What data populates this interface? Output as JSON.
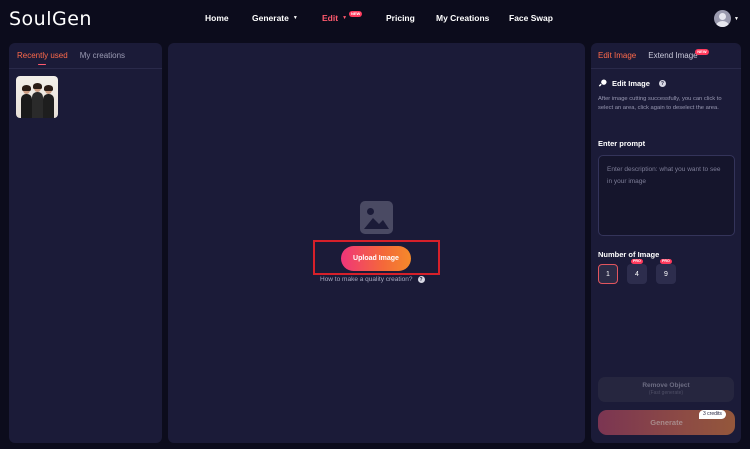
{
  "brand": {
    "logo": "SoulGen"
  },
  "nav": {
    "home": "Home",
    "generate": "Generate",
    "edit": "Edit",
    "edit_badge": "NEW",
    "pricing": "Pricing",
    "my_creations": "My Creations",
    "face_swap": "Face Swap"
  },
  "left_panel": {
    "tabs": [
      "Recently used",
      "My creations"
    ],
    "active_tab": "Recently used"
  },
  "center": {
    "upload_label": "Upload Image",
    "help_text": "How to make a quality creation?"
  },
  "right_panel": {
    "tabs": [
      "Edit Image",
      "Extend Image"
    ],
    "extend_badge": "NEW",
    "section_title": "Edit Image",
    "description": "After image cutting successfully, you can click to select an area, click again to deselect the area.",
    "prompt_label": "Enter prompt",
    "prompt_placeholder": "Enter description: what you want to see in your image",
    "number_label": "Number of Image",
    "numbers": [
      "1",
      "4",
      "9"
    ],
    "pro_badge": "PRO",
    "remove_label": "Remove Object",
    "remove_sub": "(Fast generate)",
    "generate_label": "Generate",
    "credits": "3 credits"
  },
  "colors": {
    "background": "#0c0c1c",
    "panel": "#1b1b38",
    "accent": "#ff5a6e",
    "upload_gradient_start": "#f0357a",
    "upload_gradient_end": "#f58a2a",
    "highlight": "#d6202a"
  }
}
